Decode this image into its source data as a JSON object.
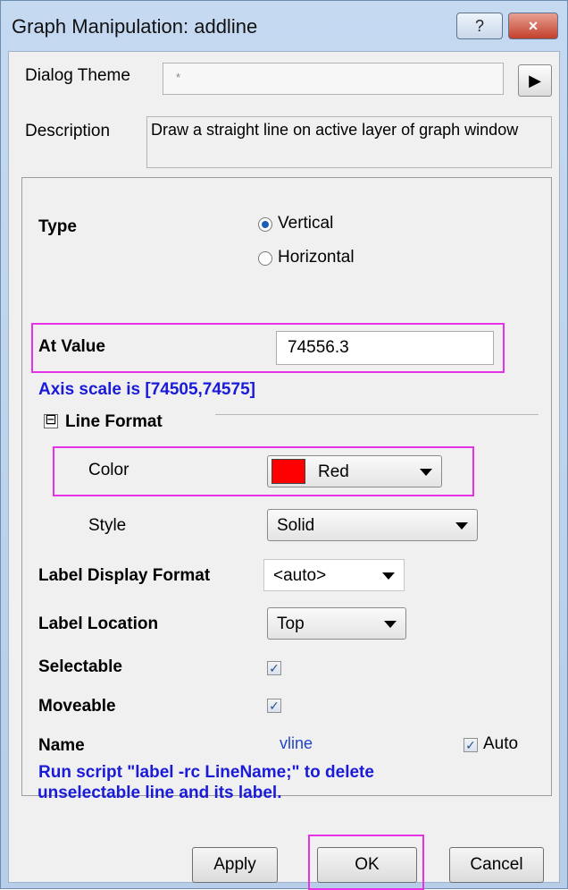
{
  "window": {
    "title": "Graph Manipulation: addline",
    "help_label": "?",
    "close_label": "×"
  },
  "theme": {
    "label": "Dialog Theme",
    "value": "*"
  },
  "description": {
    "label": "Description",
    "text": "Draw a straight line on active layer of graph window"
  },
  "form": {
    "type_label": "Type",
    "type_options": [
      "Vertical",
      "Horizontal"
    ],
    "type_selected": "Vertical",
    "at_value_label": "At Value",
    "at_value": "74556.3",
    "axis_scale_note": "Axis scale is [74505,74575]",
    "line_format_label": "Line Format",
    "line_format_toggle": "⊟",
    "color_label": "Color",
    "color_value": "Red",
    "color_hex": "#ff0000",
    "style_label": "Style",
    "style_value": "Solid",
    "label_display_format_label": "Label Display Format",
    "label_display_format_value": "<auto>",
    "label_location_label": "Label Location",
    "label_location_value": "Top",
    "selectable_label": "Selectable",
    "selectable_checked": true,
    "moveable_label": "Moveable",
    "moveable_checked": true,
    "name_label": "Name",
    "name_value": "vline",
    "auto_label": "Auto",
    "auto_checked": true,
    "note_line1": "Run script \"label -rc LineName;\" to delete",
    "note_line2": "unselectable line and its label."
  },
  "buttons": {
    "apply": "Apply",
    "ok": "OK",
    "cancel": "Cancel"
  },
  "colors": {
    "highlight": "#e633e6",
    "note_blue": "#1a1ad9",
    "link_blue": "#2244cc"
  }
}
